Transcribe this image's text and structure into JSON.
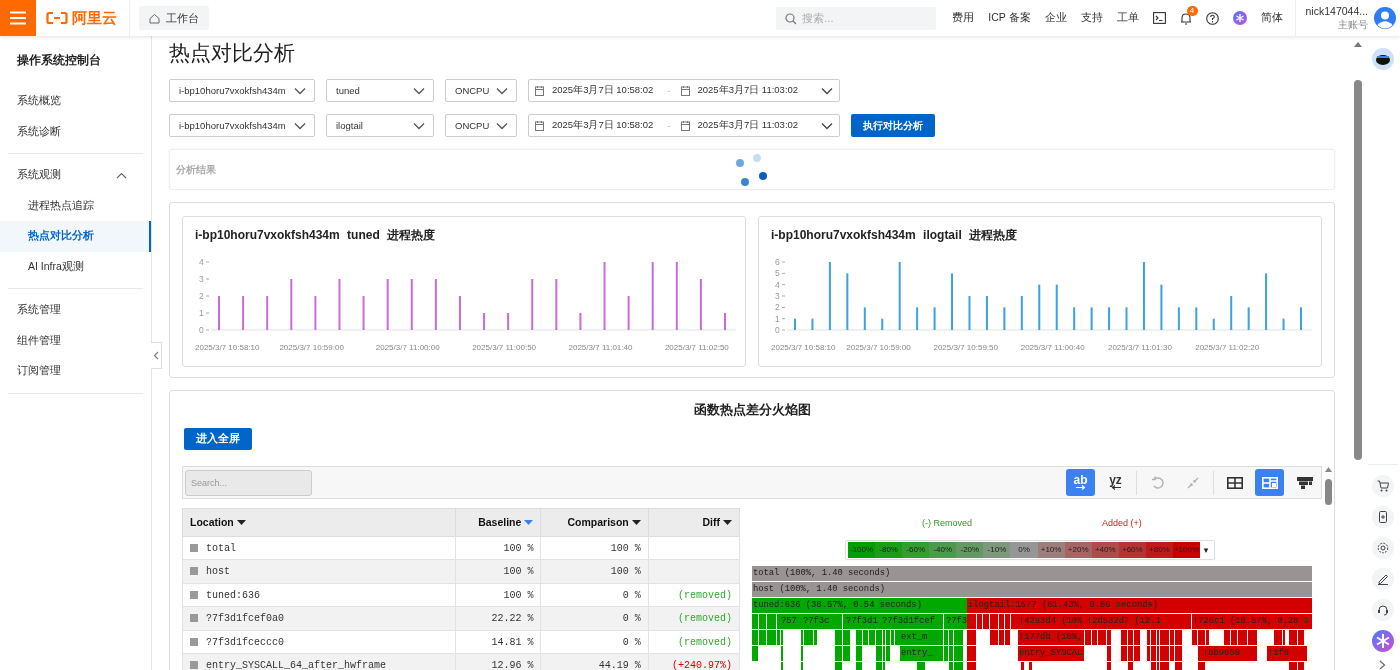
{
  "topbar": {
    "logo": "阿里云",
    "workbench": "工作台",
    "search": {
      "placeholder": "搜索..."
    },
    "links": [
      "费用",
      "ICP 备案",
      "企业",
      "支持",
      "工单"
    ],
    "notification_count": "4",
    "language": "简体",
    "account": {
      "name": "nick147044...",
      "role": "主账号"
    }
  },
  "sidebar": {
    "title": "操作系统控制台",
    "sections": [
      {
        "items": [
          {
            "label": "系统概览",
            "selected": false
          },
          {
            "label": "系统诊断",
            "selected": false
          }
        ]
      },
      {
        "items": [
          {
            "label": "系统观测",
            "selected": false,
            "expanded": true,
            "children": [
              {
                "label": "进程热点追踪",
                "selected": false
              },
              {
                "label": "热点对比分析",
                "selected": true
              },
              {
                "label": "AI Infra观测",
                "selected": false
              }
            ]
          }
        ]
      },
      {
        "items": [
          {
            "label": "系统管理",
            "selected": false
          },
          {
            "label": "组件管理",
            "selected": false
          },
          {
            "label": "订阅管理",
            "selected": false
          }
        ]
      }
    ]
  },
  "page_title": "热点对比分析",
  "filters": [
    {
      "instance": "i-bp10horu7vxokfsh434m",
      "process": "tuned",
      "event": "ONCPU",
      "start": "2025年3月7日 10:58:02",
      "separator": "-",
      "end": "2025年3月7日 11:03:02"
    },
    {
      "instance": "i-bp10horu7vxokfsh434m",
      "process": "ilogtail",
      "event": "ONCPU",
      "start": "2025年3月7日 10:58:02",
      "separator": "-",
      "end": "2025年3月7日 11:03:02"
    }
  ],
  "run_button": "执行对比分析",
  "result": {
    "label": "分析结果",
    "loading": true
  },
  "charts": [
    {
      "chart_data": {
        "type": "bar",
        "title": "i-bp10horu7vxokfsh434m tuned 进程热度",
        "categories": [
          "2025/3/7 10:58:10",
          null,
          null,
          null,
          "2025/3/7 10:59:00",
          null,
          null,
          null,
          "2025/3/7 11:00:00",
          null,
          null,
          null,
          "2025/3/7 11:00:50",
          null,
          null,
          null,
          "2025/3/7 11:01:40",
          null,
          null,
          null,
          "2025/3/7 11:02:50",
          null
        ],
        "ylim": [
          0,
          4
        ],
        "yticks": [
          0,
          1,
          2,
          3,
          4
        ],
        "series": [
          {
            "color": "#c86dd7",
            "values": [
              2,
              2,
              2,
              3,
              2,
              3,
              2,
              3,
              3,
              3,
              2,
              1,
              1,
              3,
              3,
              1,
              4,
              2,
              4,
              4,
              3,
              1
            ]
          }
        ]
      }
    },
    {
      "chart_data": {
        "type": "bar",
        "title": "i-bp10horu7vxokfsh434m ilogtail 进程热度",
        "categories": [
          "2025/3/7 10:58:10",
          null,
          null,
          null,
          null,
          "2025/3/7 10:59:00",
          null,
          null,
          null,
          null,
          "2025/3/7 10:59:50",
          null,
          null,
          null,
          null,
          "2025/3/7 11:00:40",
          null,
          null,
          null,
          null,
          "2025/3/7 11:01:30",
          null,
          null,
          null,
          null,
          "2025/3/7 11:02:20",
          null,
          null,
          null,
          null
        ],
        "ylim": [
          0,
          6
        ],
        "yticks": [
          0,
          1,
          2,
          3,
          4,
          5,
          6
        ],
        "series": [
          {
            "color": "#3ba1e0",
            "values": [
              1,
              1,
              6,
              5,
              2,
              1,
              6,
              2,
              2,
              5,
              3,
              3,
              2,
              3,
              4,
              4,
              2,
              2,
              2,
              2,
              6,
              4,
              2,
              2,
              1,
              3,
              2,
              5,
              1,
              2
            ]
          }
        ]
      }
    }
  ],
  "flame": {
    "title": "函数热点差分火焰图",
    "fullscreen_button": "进入全屏",
    "search": {
      "placeholder": "Search..."
    },
    "toolbar": [
      {
        "kind": "sort-asc",
        "label": "ab",
        "selected": true,
        "disabled": false
      },
      {
        "kind": "sort-desc",
        "label": "yz",
        "selected": false,
        "disabled": false
      },
      {
        "kind": "undo",
        "selected": false,
        "disabled": true
      },
      {
        "kind": "collapse",
        "selected": false,
        "disabled": true
      },
      {
        "kind": "table",
        "selected": false,
        "disabled": false
      },
      {
        "kind": "both",
        "selected": true,
        "disabled": false
      },
      {
        "kind": "flame",
        "selected": false,
        "disabled": false
      }
    ],
    "table": {
      "columns": [
        {
          "label": "Location",
          "sorted": false
        },
        {
          "label": "Baseline",
          "sorted": true
        },
        {
          "label": "Comparison",
          "sorted": false
        },
        {
          "label": "Diff",
          "sorted": false
        }
      ],
      "rows": [
        {
          "location": "total",
          "baseline": "100 %",
          "comparison": "100 %",
          "kind": "same"
        },
        {
          "location": "host",
          "baseline": "100 %",
          "comparison": "100 %",
          "kind": "same"
        },
        {
          "location": "tuned:636",
          "baseline": "100 %",
          "comparison": "0 %",
          "diff": "(removed)",
          "kind": "removed"
        },
        {
          "location": "?7f3d1fcef0a0",
          "baseline": "22.22 %",
          "comparison": "0 %",
          "diff": "(removed)",
          "kind": "removed"
        },
        {
          "location": "?7f3d1fceccc0",
          "baseline": "14.81 %",
          "comparison": "0 %",
          "diff": "(removed)",
          "kind": "removed"
        },
        {
          "location": "entry_SYSCALL_64_after_hwframe",
          "baseline": "12.96 %",
          "comparison": "44.19 %",
          "diff": "(+240.97%)",
          "kind": "added"
        }
      ]
    },
    "legend": {
      "removed": "(-) Removed",
      "added": "Added (+)",
      "scale": [
        "-100%",
        "-80%",
        "-60%",
        "-40%",
        "-20%",
        "-10%",
        "0%",
        "+10%",
        "+20%",
        "+40%",
        "+60%",
        "+80%",
        "+100%"
      ],
      "caret": "▾"
    },
    "frames": [
      [
        {
          "label": "total (100%, 1.40 seconds)",
          "kind": "same"
        }
      ],
      [
        {
          "label": "host (100%, 1.40 seconds)",
          "kind": "same"
        }
      ],
      [
        {
          "label": "tuned:636 (38.57%, 0.54 seconds)",
          "kind": "removed"
        },
        {
          "label": "ilogtail:1577 (61.43%, 0.86 seconds)",
          "kind": "added"
        }
      ],
      [
        {
          "label": "?57",
          "kind": "removed"
        },
        {
          "label": "?7f3c",
          "kind": "removed"
        },
        {
          "label": "?7f3d1",
          "kind": "removed"
        },
        {
          "label": "?7f3d1fcef",
          "kind": "removed"
        },
        {
          "label": "?7f3",
          "kind": "removed"
        },
        {
          "label": "!42a3d4 (10%",
          "kind": "added"
        },
        {
          "label": "!2d532d7 (12.1",
          "kind": "added"
        },
        {
          "label": "!726c1 (18.57%, 0.26 s",
          "kind": "added"
        }
      ],
      [
        {
          "label": "ext_m",
          "kind": "removed"
        },
        {
          "label": "!177db (10%,",
          "kind": "added"
        }
      ],
      [
        {
          "label": "entry_",
          "kind": "removed"
        },
        {
          "label": "entry_SYSCAL",
          "kind": "added"
        },
        {
          "label": "!6b9659",
          "kind": "added"
        },
        {
          "label": "!1f8",
          "kind": "added"
        }
      ]
    ]
  }
}
